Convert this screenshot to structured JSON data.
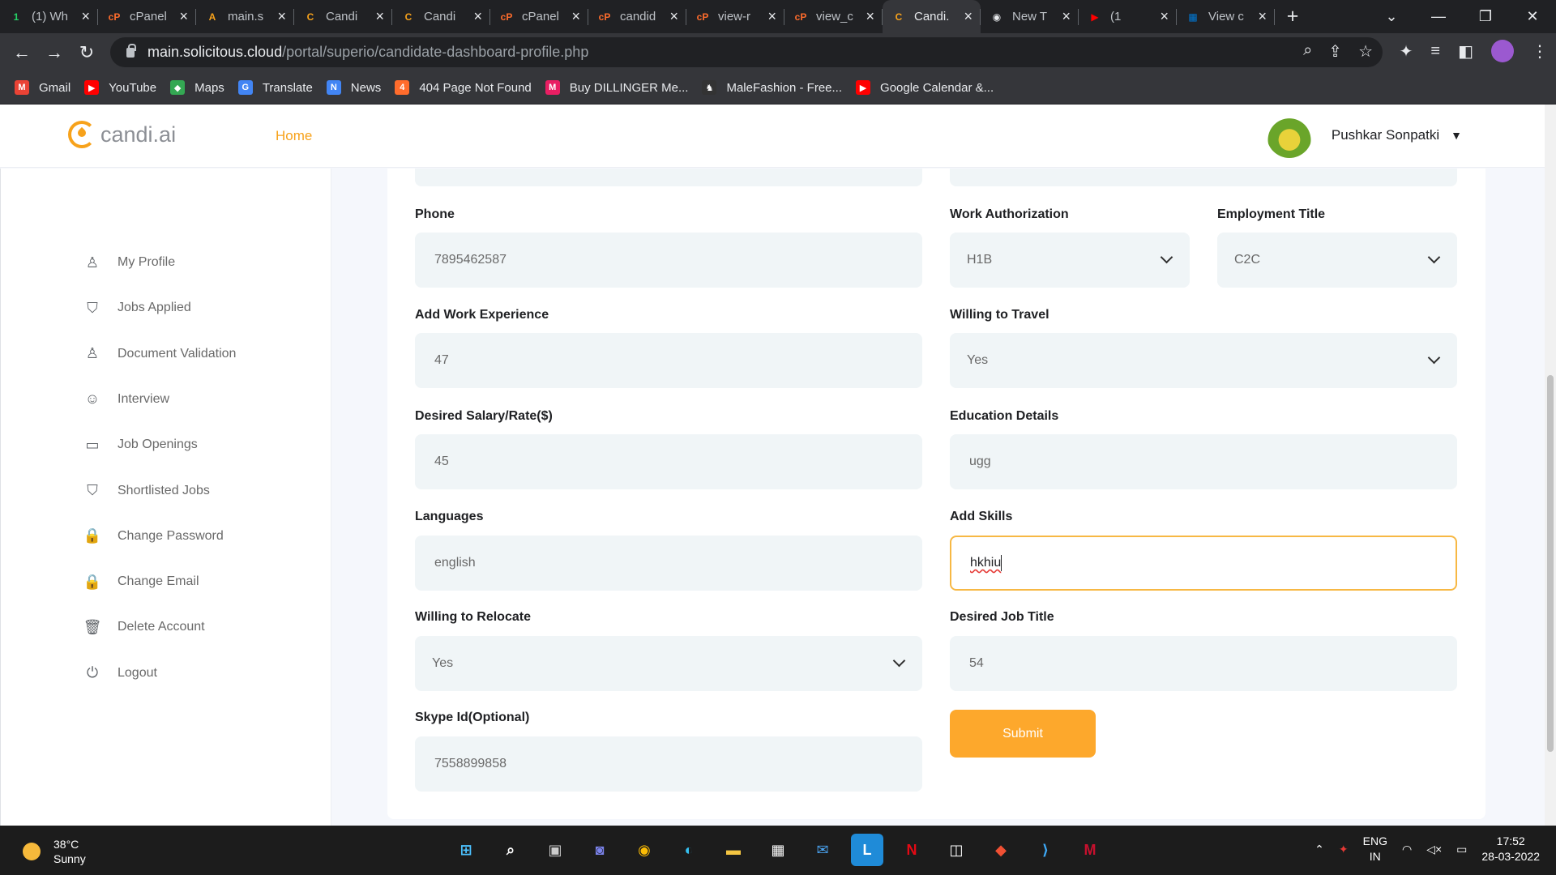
{
  "browser": {
    "tabs": [
      {
        "label": "(1) Wh",
        "icon": "whatsapp-icon",
        "color": "#25d366",
        "glyph": "1"
      },
      {
        "label": "cPanel",
        "icon": "cpanel-icon",
        "color": "#ff6c2c",
        "glyph": "cP"
      },
      {
        "label": "main.s",
        "icon": "cpanel-logo-icon",
        "color": "#f7a21b",
        "glyph": "A"
      },
      {
        "label": "Candi",
        "icon": "candi-icon",
        "color": "#f7a21b",
        "glyph": "C"
      },
      {
        "label": "Candi",
        "icon": "candi-icon",
        "color": "#f7a21b",
        "glyph": "C"
      },
      {
        "label": "cPanel",
        "icon": "cpanel-icon",
        "color": "#ff6c2c",
        "glyph": "cP"
      },
      {
        "label": "candid",
        "icon": "cpanel-icon",
        "color": "#ff6c2c",
        "glyph": "cP"
      },
      {
        "label": "view-r",
        "icon": "cpanel-icon",
        "color": "#ff6c2c",
        "glyph": "cP"
      },
      {
        "label": "view_c",
        "icon": "cpanel-icon",
        "color": "#ff6c2c",
        "glyph": "cP"
      },
      {
        "label": "Candi.",
        "icon": "candi-icon",
        "color": "#f7a21b",
        "glyph": "C",
        "active": true
      },
      {
        "label": "New T",
        "icon": "chrome-icon",
        "color": "#e8eaed",
        "glyph": "◉"
      },
      {
        "label": "(1",
        "icon": "youtube-icon",
        "color": "#ff0000",
        "glyph": "▶"
      },
      {
        "label": "View c",
        "icon": "windows-icon",
        "color": "#0078d4",
        "glyph": "▦"
      }
    ],
    "url_host": "main.solicitous.cloud",
    "url_path": "/portal/superio/candidate-dashboard-profile.php",
    "bookmarks": [
      {
        "label": "Gmail",
        "icon": "gmail-icon",
        "color": "#ea4335",
        "glyph": "M"
      },
      {
        "label": "YouTube",
        "icon": "youtube-icon",
        "color": "#ff0000",
        "glyph": "▶"
      },
      {
        "label": "Maps",
        "icon": "maps-icon",
        "color": "#34a853",
        "glyph": "◆"
      },
      {
        "label": "Translate",
        "icon": "translate-icon",
        "color": "#4285f4",
        "glyph": "G"
      },
      {
        "label": "News",
        "icon": "news-icon",
        "color": "#4285f4",
        "glyph": "N"
      },
      {
        "label": "404 Page Not Found",
        "icon": "page-icon",
        "color": "#ff6c2c",
        "glyph": "4"
      },
      {
        "label": "Buy DILLINGER Me...",
        "icon": "myntra-icon",
        "color": "#e91e63",
        "glyph": "M"
      },
      {
        "label": "MaleFashion - Free...",
        "icon": "malefashion-icon",
        "color": "#333333",
        "glyph": "♞"
      },
      {
        "label": "Google Calendar &...",
        "icon": "youtube-icon",
        "color": "#ff0000",
        "glyph": "▶"
      }
    ]
  },
  "header": {
    "logo_text": "candi.ai",
    "nav_home": "Home",
    "user_name": "Pushkar Sonpatki"
  },
  "sidebar": {
    "items": [
      {
        "label": "My Profile",
        "icon": "user-icon",
        "glyph": "♙"
      },
      {
        "label": "Jobs Applied",
        "icon": "bookmark-icon",
        "glyph": "⛉"
      },
      {
        "label": "Document Validation",
        "icon": "user-icon",
        "glyph": "♙"
      },
      {
        "label": "Interview",
        "icon": "reddit-icon",
        "glyph": "☺"
      },
      {
        "label": "Job Openings",
        "icon": "briefcase-icon",
        "glyph": "▭"
      },
      {
        "label": "Shortlisted Jobs",
        "icon": "bookmark-icon",
        "glyph": "⛉"
      },
      {
        "label": "Change Password",
        "icon": "lock-icon",
        "glyph": "🔒"
      },
      {
        "label": "Change Email",
        "icon": "lock-icon",
        "glyph": "🔒"
      },
      {
        "label": "Delete Account",
        "icon": "trash-icon",
        "glyph": "🗑"
      },
      {
        "label": "Logout",
        "icon": "logout-icon",
        "glyph": "⏻"
      }
    ]
  },
  "form": {
    "phone": {
      "label": "Phone",
      "value": "7895462587"
    },
    "work_authorization": {
      "label": "Work Authorization",
      "value": "H1B"
    },
    "employment_title": {
      "label": "Employment Title",
      "value": "C2C"
    },
    "work_experience": {
      "label": "Add Work Experience",
      "value": "47"
    },
    "willing_to_travel": {
      "label": "Willing to Travel",
      "value": "Yes"
    },
    "desired_salary": {
      "label": "Desired Salary/Rate($)",
      "value": "45"
    },
    "education_details": {
      "label": "Education Details",
      "value": "ugg"
    },
    "languages": {
      "label": "Languages",
      "value": "english"
    },
    "add_skills": {
      "label": "Add Skills",
      "value": "hkhiu"
    },
    "willing_to_relocate": {
      "label": "Willing to Relocate",
      "value": "Yes"
    },
    "desired_job_title": {
      "label": "Desired Job Title",
      "value": "54"
    },
    "skype_id": {
      "label": "Skype Id(Optional)",
      "value": "7558899858"
    },
    "submit_label": "Submit"
  },
  "taskbar": {
    "temperature": "38°C",
    "weather": "Sunny",
    "lang_top": "ENG",
    "lang_bottom": "IN",
    "time": "17:52",
    "date": "28-03-2022"
  },
  "colors": {
    "accent": "#fda82c",
    "field_bg": "#f0f5f7",
    "focus_border": "#f7b844"
  }
}
